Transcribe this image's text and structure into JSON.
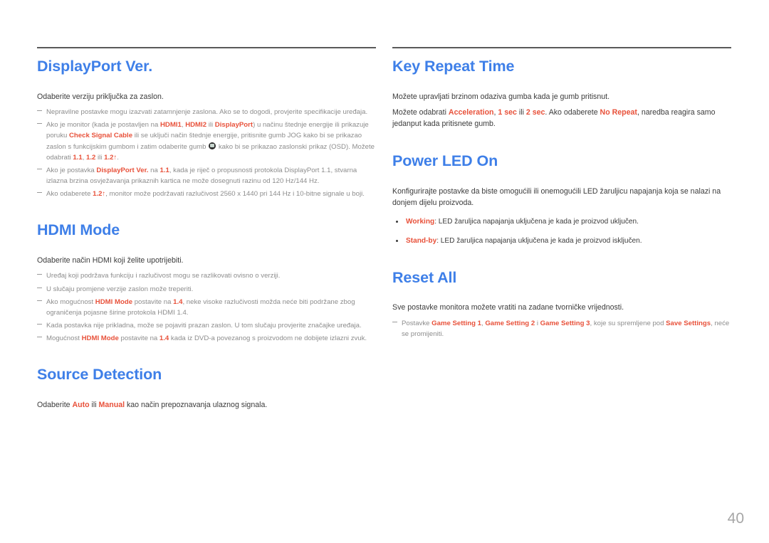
{
  "page": {
    "number": "40"
  },
  "left_column": {
    "sections": [
      {
        "title": "DisplayPort Ver.",
        "lead": "Odaberite verziju priključka za zaslon.",
        "notes": [
          {
            "parts": [
              {
                "t": "Nepravilne postavke mogu izazvati zatamnjenje zaslona. Ako se to dogodi, provjerite specifikacije uređaja.",
                "hl": false
              }
            ]
          },
          {
            "parts": [
              {
                "t": "Ako je monitor (kada je postavljen na ",
                "hl": false
              },
              {
                "t": "HDMI1",
                "hl": true
              },
              {
                "t": ", ",
                "hl": false
              },
              {
                "t": "HDMI2",
                "hl": true
              },
              {
                "t": " ili ",
                "hl": false
              },
              {
                "t": "DisplayPort",
                "hl": true
              },
              {
                "t": ") u načinu štednje energije ili prikazuje poruku ",
                "hl": false
              },
              {
                "t": "Check Signal Cable",
                "hl": true
              },
              {
                "t": " ili se uključi način štednje energije, pritisnite gumb JOG kako bi se prikazao zaslon s funkcijskim gumbom i zatim odaberite gumb ",
                "hl": false
              },
              {
                "t": "JOG-ICON",
                "icon": true
              },
              {
                "t": " kako bi se prikazao zaslonski prikaz (OSD). Možete odabrati ",
                "hl": false
              },
              {
                "t": "1.1",
                "hl": true
              },
              {
                "t": ", ",
                "hl": false
              },
              {
                "t": "1.2",
                "hl": true
              },
              {
                "t": " ili ",
                "hl": false
              },
              {
                "t": "1.2↑",
                "hl": true
              },
              {
                "t": ".",
                "hl": false
              }
            ]
          },
          {
            "parts": [
              {
                "t": "Ako je postavka ",
                "hl": false
              },
              {
                "t": "DisplayPort Ver.",
                "hl": true
              },
              {
                "t": " na ",
                "hl": false
              },
              {
                "t": "1.1",
                "hl": true
              },
              {
                "t": ", kada je riječ o propusnosti protokola DisplayPort 1.1, stvarna izlazna brzina osvježavanja prikaznih kartica ne može dosegnuti razinu od 120 Hz/144 Hz.",
                "hl": false
              }
            ]
          },
          {
            "parts": [
              {
                "t": "Ako odaberete ",
                "hl": false
              },
              {
                "t": "1.2↑",
                "hl": true
              },
              {
                "t": ", monitor može podržavati razlučivost 2560 x 1440 pri 144 Hz i 10-bitne signale u boji.",
                "hl": false
              }
            ]
          }
        ]
      },
      {
        "title": "HDMI Mode",
        "lead": "Odaberite način HDMI koji želite upotrijebiti.",
        "notes": [
          {
            "parts": [
              {
                "t": "Uređaj koji podržava funkciju i razlučivost mogu se razlikovati ovisno o verziji.",
                "hl": false
              }
            ]
          },
          {
            "parts": [
              {
                "t": "U slučaju promjene verzije zaslon može treperiti.",
                "hl": false
              }
            ]
          },
          {
            "parts": [
              {
                "t": "Ako mogućnost ",
                "hl": false
              },
              {
                "t": "HDMI Mode",
                "hl": true
              },
              {
                "t": " postavite na ",
                "hl": false
              },
              {
                "t": "1.4",
                "hl": true
              },
              {
                "t": ", neke visoke razlučivosti možda neće biti podržane zbog ograničenja pojasne širine protokola HDMI 1.4.",
                "hl": false
              }
            ]
          },
          {
            "parts": [
              {
                "t": "Kada postavka nije prikladna, može se pojaviti prazan zaslon. U tom slučaju provjerite značajke uređaja.",
                "hl": false
              }
            ]
          },
          {
            "parts": [
              {
                "t": "Mogućnost ",
                "hl": false
              },
              {
                "t": "HDMI Mode",
                "hl": true
              },
              {
                "t": " postavite na ",
                "hl": false
              },
              {
                "t": "1.4",
                "hl": true
              },
              {
                "t": " kada iz DVD-a povezanog s proizvodom ne dobijete izlazni zvuk.",
                "hl": false
              }
            ]
          }
        ]
      },
      {
        "title": "Source Detection",
        "lead_parts": [
          {
            "t": "Odaberite ",
            "hl": false
          },
          {
            "t": "Auto",
            "hl": true
          },
          {
            "t": " ili ",
            "hl": false
          },
          {
            "t": "Manual",
            "hl": true
          },
          {
            "t": " kao način prepoznavanja ulaznog signala.",
            "hl": false
          }
        ],
        "notes": []
      }
    ]
  },
  "right_column": {
    "sections": [
      {
        "title": "Key Repeat Time",
        "lead": "Možete upravljati brzinom odaziva gumba kada je gumb pritisnut.",
        "lead2_parts": [
          {
            "t": "Možete odabrati ",
            "hl": false
          },
          {
            "t": "Acceleration",
            "hl": true
          },
          {
            "t": ", ",
            "hl": false
          },
          {
            "t": "1 sec",
            "hl": true
          },
          {
            "t": " ili ",
            "hl": false
          },
          {
            "t": "2 sec",
            "hl": true
          },
          {
            "t": ". Ako odaberete ",
            "hl": false
          },
          {
            "t": "No Repeat",
            "hl": true
          },
          {
            "t": ", naredba reagira samo jedanput kada pritisnete gumb.",
            "hl": false
          }
        ]
      },
      {
        "title": "Power LED On",
        "lead": "Konfigurirajte postavke da biste omogućili ili onemogućili LED žaruljicu napajanja koja se nalazi na donjem dijelu proizvoda.",
        "bullets": [
          {
            "parts": [
              {
                "t": "Working",
                "hl": true
              },
              {
                "t": ": LED žaruljica napajanja uključena je kada je proizvod uključen.",
                "hl": false
              }
            ]
          },
          {
            "parts": [
              {
                "t": "Stand-by",
                "hl": true
              },
              {
                "t": ": LED žaruljica napajanja uključena je kada je proizvod isključen.",
                "hl": false
              }
            ]
          }
        ]
      },
      {
        "title": "Reset All",
        "lead": "Sve postavke monitora možete vratiti na zadane tvorničke vrijednosti.",
        "notes": [
          {
            "parts": [
              {
                "t": "Postavke ",
                "hl": false
              },
              {
                "t": "Game Setting 1",
                "hl": true
              },
              {
                "t": ", ",
                "hl": false
              },
              {
                "t": "Game Setting 2",
                "hl": true
              },
              {
                "t": " i ",
                "hl": false
              },
              {
                "t": "Game Setting 3",
                "hl": true
              },
              {
                "t": ", koje su spremljene pod ",
                "hl": false
              },
              {
                "t": "Save Settings",
                "hl": true
              },
              {
                "t": ", neće se promijeniti.",
                "hl": false
              }
            ]
          }
        ]
      }
    ]
  },
  "colors": {
    "heading": "#3e7fe8",
    "accent": "#e8513a",
    "body": "#3b3b3b",
    "note": "#8d8d8d",
    "rule": "#5a5a5a",
    "page_number": "#a6a6a6"
  }
}
